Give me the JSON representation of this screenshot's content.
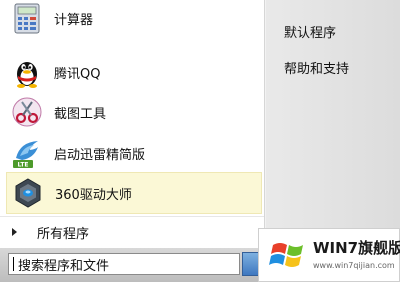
{
  "start_menu": {
    "programs": [
      {
        "label": "计算器",
        "icon": "calculator-icon"
      },
      {
        "label": "腾讯QQ",
        "icon": "qq-penguin-icon"
      },
      {
        "label": "截图工具",
        "icon": "snipping-tool-icon"
      },
      {
        "label": "启动迅雷精简版",
        "icon": "thunder-lite-icon"
      },
      {
        "label": "360驱动大师",
        "icon": "360-driver-master-icon"
      }
    ],
    "all_programs_label": "所有程序",
    "right_links": [
      "默认程序",
      "帮助和支持"
    ],
    "search_value": "搜索程序和文件"
  },
  "watermark": {
    "brand": "WIN7旗舰版",
    "url": "www.win7qijian.com"
  },
  "colors": {
    "highlight_bg": "#fbf8d6",
    "right_panel_bg": "#e2e2e2",
    "bottom_strip_bg": "#cacaca"
  }
}
